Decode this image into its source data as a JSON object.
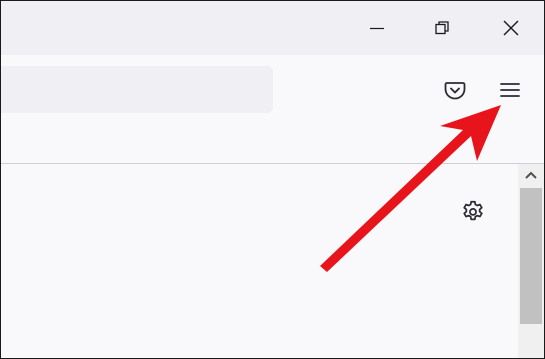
{
  "window": {
    "controls": [
      {
        "name": "minimize-button",
        "icon": "minimize-icon"
      },
      {
        "name": "restore-button",
        "icon": "restore-icon"
      },
      {
        "name": "close-button",
        "icon": "close-icon"
      }
    ]
  },
  "toolbar": {
    "url_value": "",
    "buttons": [
      {
        "name": "pocket-button",
        "icon": "pocket-icon"
      },
      {
        "name": "app-menu-button",
        "icon": "hamburger-menu-icon"
      }
    ]
  },
  "content": {
    "settings_icon": "gear-icon"
  },
  "annotation": {
    "arrow_color": "#e8141b",
    "points_to": "app-menu-button"
  }
}
